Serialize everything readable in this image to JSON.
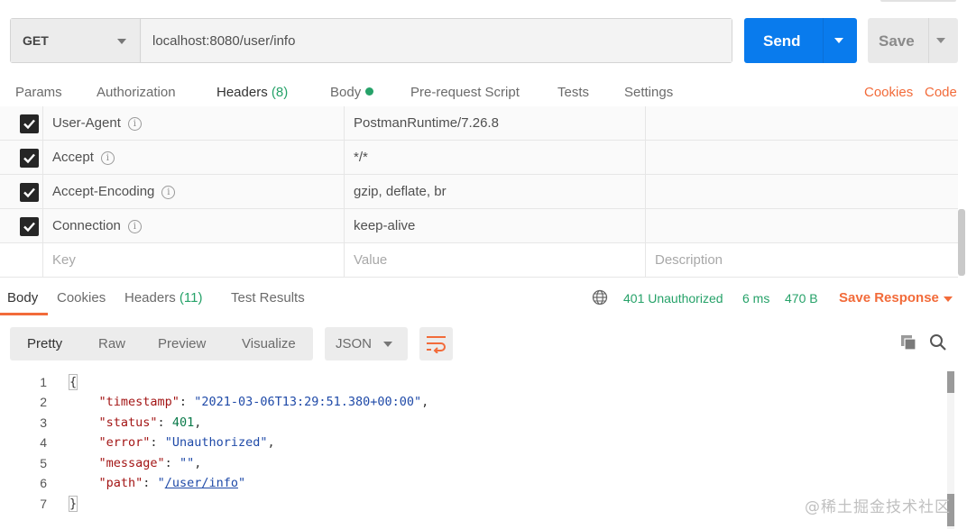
{
  "request": {
    "method": "GET",
    "url": "localhost:8080/user/info",
    "send_label": "Send",
    "save_label": "Save"
  },
  "request_tabs": [
    {
      "label": "Params"
    },
    {
      "label": "Authorization"
    },
    {
      "label": "Headers",
      "count": "(8)"
    },
    {
      "label": "Body"
    },
    {
      "label": "Pre-request Script"
    },
    {
      "label": "Tests"
    },
    {
      "label": "Settings"
    }
  ],
  "request_links": {
    "cookies": "Cookies",
    "code": "Code"
  },
  "headers": [
    {
      "key": "User-Agent",
      "value": "PostmanRuntime/7.26.8",
      "checked": true
    },
    {
      "key": "Accept",
      "value": "*/*",
      "checked": true
    },
    {
      "key": "Accept-Encoding",
      "value": "gzip, deflate, br",
      "checked": true
    },
    {
      "key": "Connection",
      "value": "keep-alive",
      "checked": true
    }
  ],
  "header_placeholders": {
    "key": "Key",
    "value": "Value",
    "description": "Description"
  },
  "response_tabs": [
    {
      "label": "Body"
    },
    {
      "label": "Cookies"
    },
    {
      "label": "Headers",
      "count": "(11)"
    },
    {
      "label": "Test Results"
    }
  ],
  "response_status": {
    "status": "401 Unauthorized",
    "time": "6 ms",
    "size": "470 B",
    "save_response": "Save Response"
  },
  "view_options": [
    "Pretty",
    "Raw",
    "Preview",
    "Visualize"
  ],
  "format": "JSON",
  "code": {
    "line_numbers": [
      "1",
      "2",
      "3",
      "4",
      "5",
      "6",
      "7"
    ],
    "open_brace": "{",
    "close_brace": "}",
    "fields": [
      {
        "key": "\"timestamp\"",
        "value": "\"2021-03-06T13:29:51.380+00:00\"",
        "type": "string",
        "comma": ","
      },
      {
        "key": "\"status\"",
        "value": "401",
        "type": "number",
        "comma": ","
      },
      {
        "key": "\"error\"",
        "value": "\"Unauthorized\"",
        "type": "string",
        "comma": ","
      },
      {
        "key": "\"message\"",
        "value": "\"\"",
        "type": "string",
        "comma": ","
      },
      {
        "key": "\"path\"",
        "value_open": "\"",
        "value_link": "/user/info",
        "value_close": "\"",
        "type": "link",
        "comma": ""
      }
    ]
  },
  "watermark": "@稀土掘金技术社区",
  "colors": {
    "accent": "#f26b3a",
    "send": "#097bed",
    "success": "#26a269"
  },
  "icons": [
    "chevron-down-icon",
    "check-icon",
    "info-icon",
    "globe-icon",
    "wrap-lines-icon",
    "copy-icon",
    "search-icon"
  ]
}
